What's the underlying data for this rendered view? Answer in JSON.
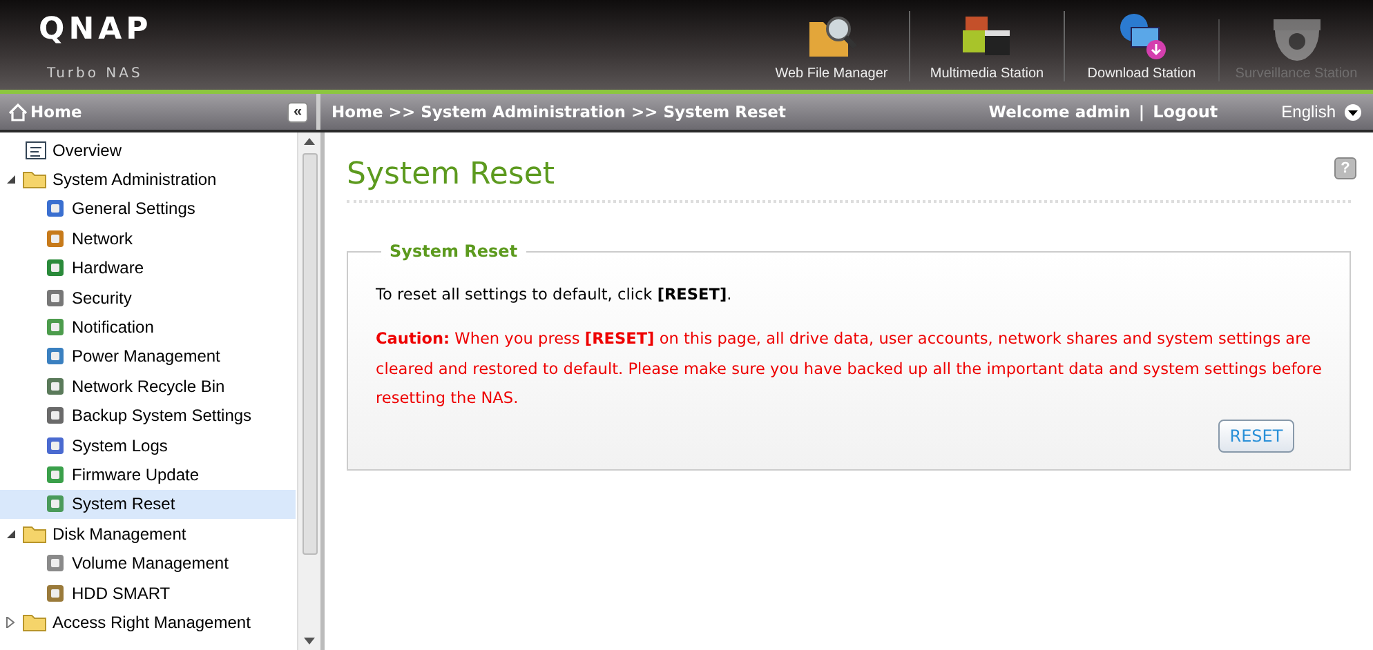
{
  "header": {
    "logo": "QNAP",
    "subtitle": "Turbo NAS",
    "apps": [
      {
        "label": "Web File Manager",
        "kind": "files",
        "disabled": false
      },
      {
        "label": "Multimedia Station",
        "kind": "media",
        "disabled": false
      },
      {
        "label": "Download Station",
        "kind": "download",
        "disabled": false
      },
      {
        "label": "Surveillance Station",
        "kind": "camera",
        "disabled": true
      }
    ]
  },
  "sidebar": {
    "title": "Home",
    "collapse_glyph": "«",
    "items": [
      {
        "label": "Overview",
        "selected": false
      },
      {
        "label": "System Administration",
        "selected": false,
        "expanded": true,
        "children": [
          {
            "label": "General Settings",
            "selected": false
          },
          {
            "label": "Network",
            "selected": false
          },
          {
            "label": "Hardware",
            "selected": false
          },
          {
            "label": "Security",
            "selected": false
          },
          {
            "label": "Notification",
            "selected": false
          },
          {
            "label": "Power Management",
            "selected": false
          },
          {
            "label": "Network Recycle Bin",
            "selected": false
          },
          {
            "label": "Backup System Settings",
            "selected": false
          },
          {
            "label": "System Logs",
            "selected": false
          },
          {
            "label": "Firmware Update",
            "selected": false
          },
          {
            "label": "System Reset",
            "selected": true
          }
        ]
      },
      {
        "label": "Disk Management",
        "selected": false,
        "expanded": true,
        "children": [
          {
            "label": "Volume Management",
            "selected": false
          },
          {
            "label": "HDD SMART",
            "selected": false
          }
        ]
      },
      {
        "label": "Access Right Management",
        "selected": false,
        "expanded": false
      }
    ]
  },
  "topbar": {
    "breadcrumb": "Home >> System Administration >> System Reset",
    "welcome": "Welcome admin",
    "separator": "|",
    "logout": "Logout",
    "language": "English"
  },
  "content": {
    "title": "System Reset",
    "help": "?",
    "panel": {
      "legend": "System Reset",
      "intro": "To reset all settings to default, click **[RESET]**.",
      "caution": "**Caution:** When you press **[RESET]** on this page, all drive data, user accounts, network shares and system settings are cleared and restored to default. Please make sure you have backed up all the important data and system settings before resetting the NAS.",
      "button": "RESET"
    }
  }
}
